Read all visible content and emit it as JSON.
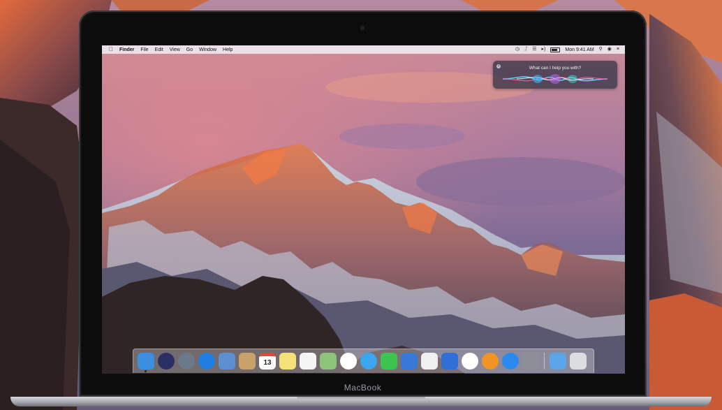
{
  "menubar": {
    "apple_icon": "apple-icon",
    "app_name": "Finder",
    "menus": [
      "File",
      "Edit",
      "View",
      "Go",
      "Window",
      "Help"
    ],
    "status_icons": [
      "time-machine-icon",
      "bluetooth-icon",
      "wifi-icon",
      "volume-icon",
      "battery-icon"
    ],
    "clock": "Mon 9:41 AM",
    "right_icons": [
      "spotlight-icon",
      "siri-icon",
      "notification-center-icon"
    ]
  },
  "siri": {
    "prompt": "What can I help you with?"
  },
  "device": {
    "label": "MacBook"
  },
  "dock": {
    "apps": [
      {
        "name": "finder-icon",
        "color": "#3b8fe0",
        "running": true
      },
      {
        "name": "siri-icon",
        "color": "#2a2f63"
      },
      {
        "name": "launchpad-icon",
        "color": "#6b7a88"
      },
      {
        "name": "safari-icon",
        "color": "#1f7fe0"
      },
      {
        "name": "mail-icon",
        "color": "#5b8fd0"
      },
      {
        "name": "contacts-icon",
        "color": "#c9a26a"
      },
      {
        "name": "calendar-icon",
        "color": "#ffffff",
        "text": "13"
      },
      {
        "name": "notes-icon",
        "color": "#f5e17a"
      },
      {
        "name": "reminders-icon",
        "color": "#f5f5f5"
      },
      {
        "name": "maps-icon",
        "color": "#8cc47a"
      },
      {
        "name": "photos-icon",
        "color": "#ffffff"
      },
      {
        "name": "messages-icon",
        "color": "#3aa7f0"
      },
      {
        "name": "facetime-icon",
        "color": "#3cc44e"
      },
      {
        "name": "keynote-icon",
        "color": "#3a78d8"
      },
      {
        "name": "numbers-icon",
        "color": "#f0f0f0"
      },
      {
        "name": "keynote-podium-icon",
        "color": "#2f6fd6"
      },
      {
        "name": "itunes-icon",
        "color": "#ffffff"
      },
      {
        "name": "ibooks-icon",
        "color": "#f29424"
      },
      {
        "name": "app-store-icon",
        "color": "#2a8af0"
      },
      {
        "name": "system-preferences-icon",
        "color": "#8c8f95"
      }
    ],
    "trailing": [
      {
        "name": "downloads-folder-icon",
        "color": "#5aa6e8"
      },
      {
        "name": "trash-icon",
        "color": "#dcdde0"
      }
    ]
  }
}
